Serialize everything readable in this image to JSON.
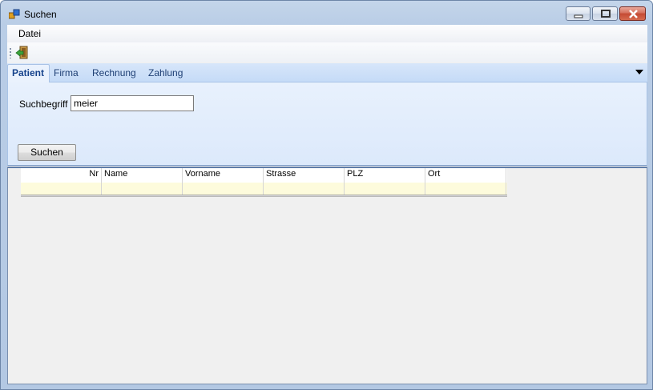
{
  "window": {
    "title": "Suchen"
  },
  "menu": {
    "items": [
      "Datei"
    ]
  },
  "tabs": [
    {
      "label": "Patient",
      "active": true
    },
    {
      "label": "Firma",
      "active": false
    },
    {
      "label": "Rechnung",
      "active": false
    },
    {
      "label": "Zahlung",
      "active": false
    }
  ],
  "search": {
    "label": "Suchbegriff",
    "value": "meier",
    "button_label": "Suchen"
  },
  "grid": {
    "columns": [
      "Nr",
      "Name",
      "Vorname",
      "Strasse",
      "PLZ",
      "Ort"
    ],
    "rows": [
      [
        "",
        "",
        "",
        "",
        "",
        ""
      ]
    ]
  },
  "icons": {
    "app": "app-icon",
    "toolbar_exit": "exit-door-icon"
  },
  "colors": {
    "accent": "#15428b",
    "new_row": "#fdfbdc"
  }
}
